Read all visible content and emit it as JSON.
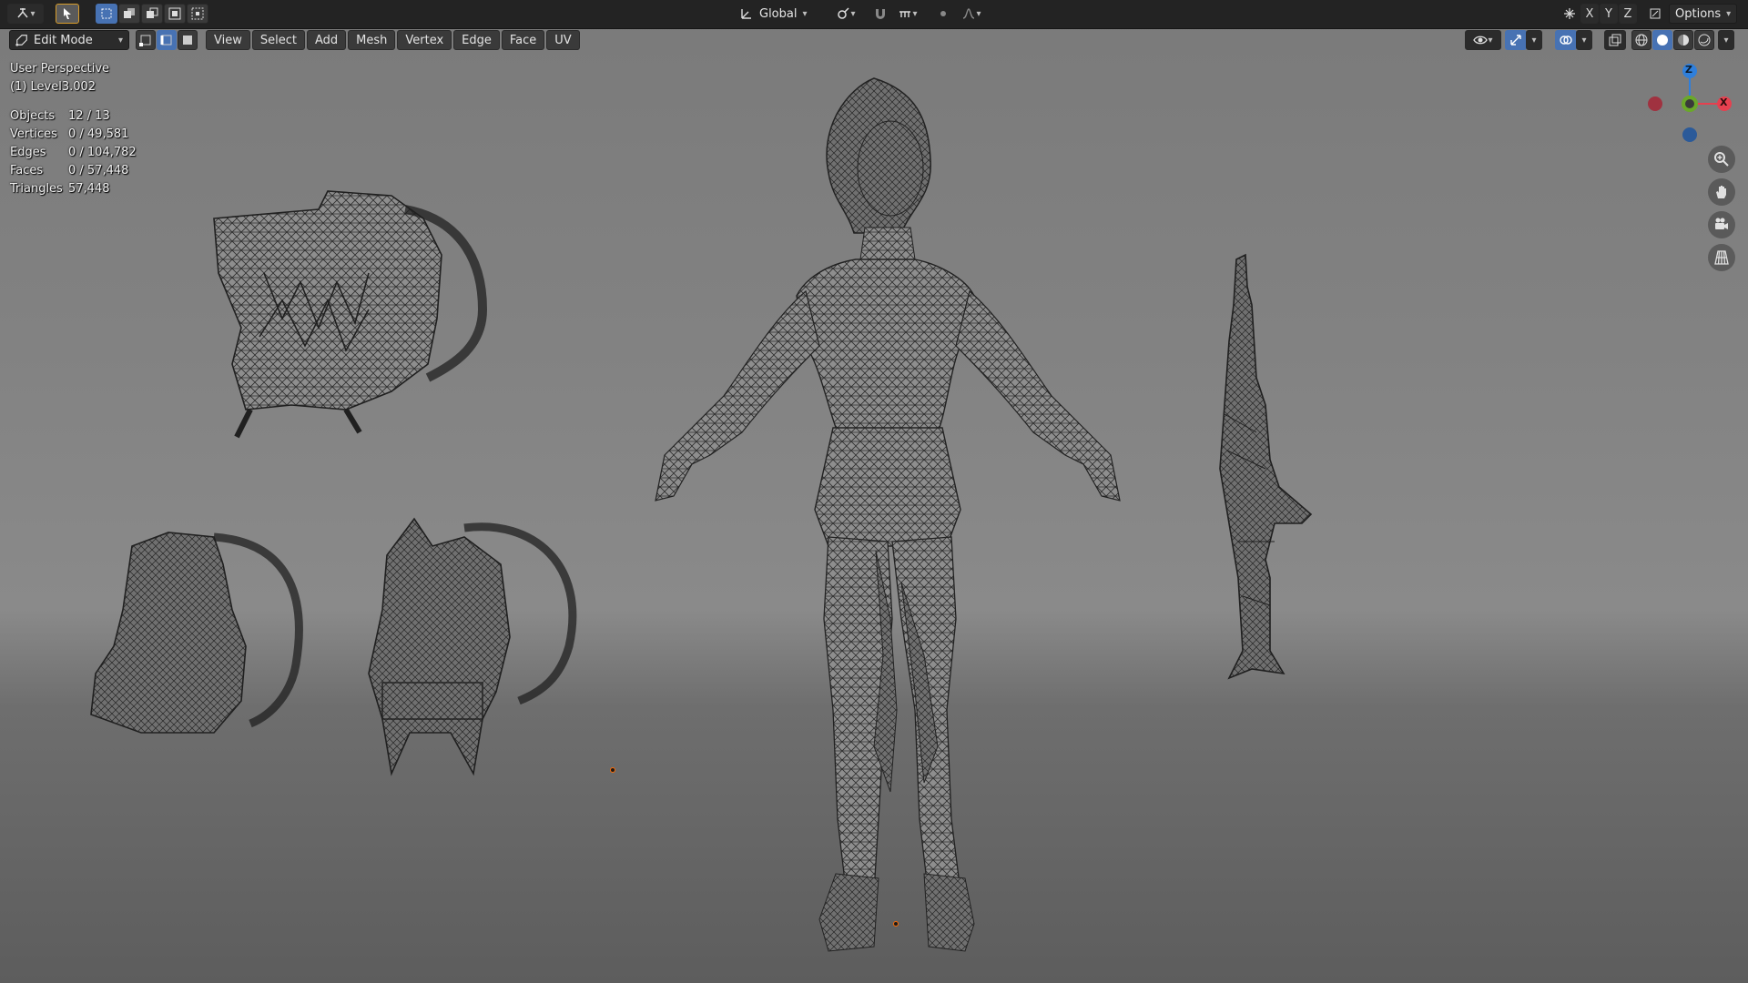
{
  "header": {
    "transform_orientation": "Global",
    "axis_labels": [
      "X",
      "Y",
      "Z"
    ],
    "options_label": "Options"
  },
  "menubar": {
    "mode": "Edit Mode",
    "menus": [
      "View",
      "Select",
      "Add",
      "Mesh",
      "Vertex",
      "Edge",
      "Face",
      "UV"
    ]
  },
  "viewport": {
    "view_name": "User Perspective",
    "object_name": "(1) Level3.002",
    "stats": [
      {
        "label": "Objects",
        "value": "12 / 13"
      },
      {
        "label": "Vertices",
        "value": "0 / 49,581"
      },
      {
        "label": "Edges",
        "value": "0 / 104,782"
      },
      {
        "label": "Faces",
        "value": "0 / 57,448"
      },
      {
        "label": "Triangles",
        "value": "57,448"
      }
    ],
    "gizmo_axes": [
      "Z",
      "X"
    ],
    "models": [
      "character-mesh",
      "rifle-mesh",
      "monster-backpack-mesh",
      "backpack-mesh-left",
      "backpack-mesh-right"
    ]
  },
  "colors": {
    "axis_x": "#e6404f",
    "axis_y": "#6aa829",
    "axis_z": "#2f7fdb",
    "selection_active": "#4772b3",
    "origin_point": "#ff6a00"
  }
}
